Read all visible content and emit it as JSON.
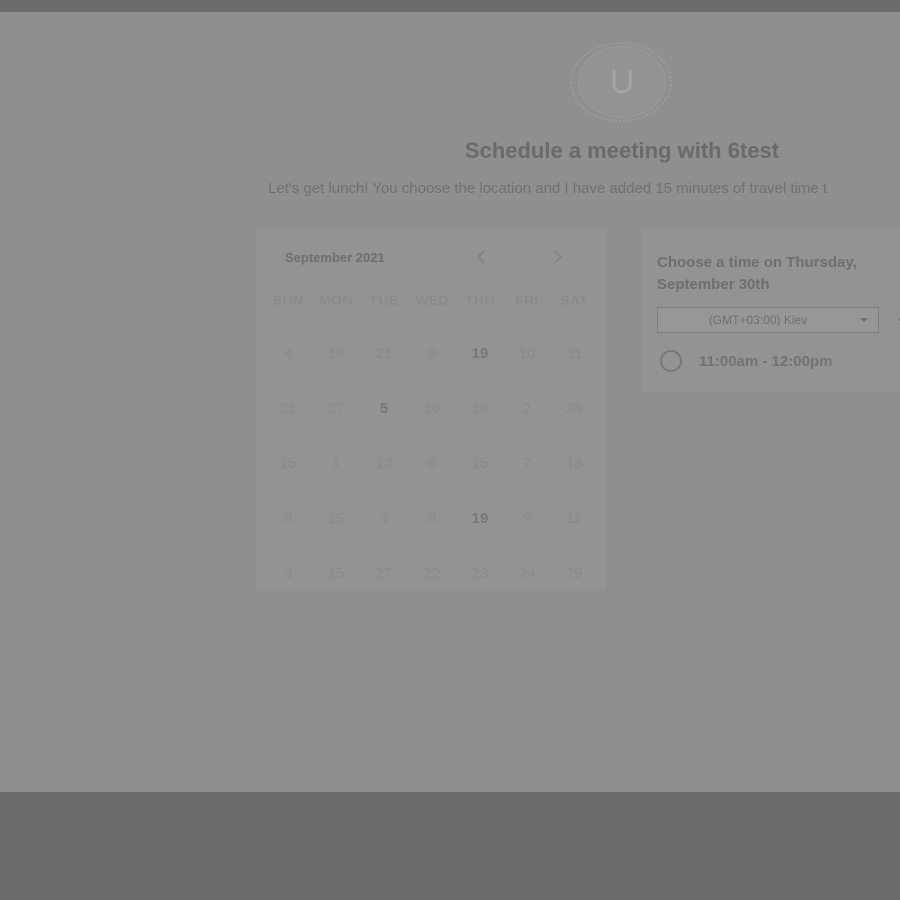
{
  "header": {
    "avatar_initial": "U",
    "title": "Schedule a meeting with 6test",
    "subtitle": "Let's get lunch! You choose the location and I have added 15 minutes of travel time t"
  },
  "calendar": {
    "month_label": "September 2021",
    "weekdays": [
      "SUN",
      "MON",
      "TUE",
      "WED",
      "THU",
      "FRI",
      "SAT"
    ],
    "weeks": [
      [
        "4",
        "14",
        "21",
        "9",
        "19",
        "10",
        "31"
      ],
      [
        "21",
        "27",
        "5",
        "16",
        "14",
        "2",
        "28"
      ],
      [
        "15",
        "1",
        "12",
        "6",
        "15",
        "7",
        "18"
      ],
      [
        "8",
        "15",
        "3",
        "8",
        "19",
        "9",
        "11"
      ],
      [
        "3",
        "15",
        "27",
        "22",
        "23",
        "24",
        "29"
      ]
    ]
  },
  "times": {
    "heading": "Choose a time on Thursday, September 30th",
    "timezone": "(GMT+03:00) Kiev",
    "slots": [
      "11:00am - 12:00pm"
    ]
  }
}
